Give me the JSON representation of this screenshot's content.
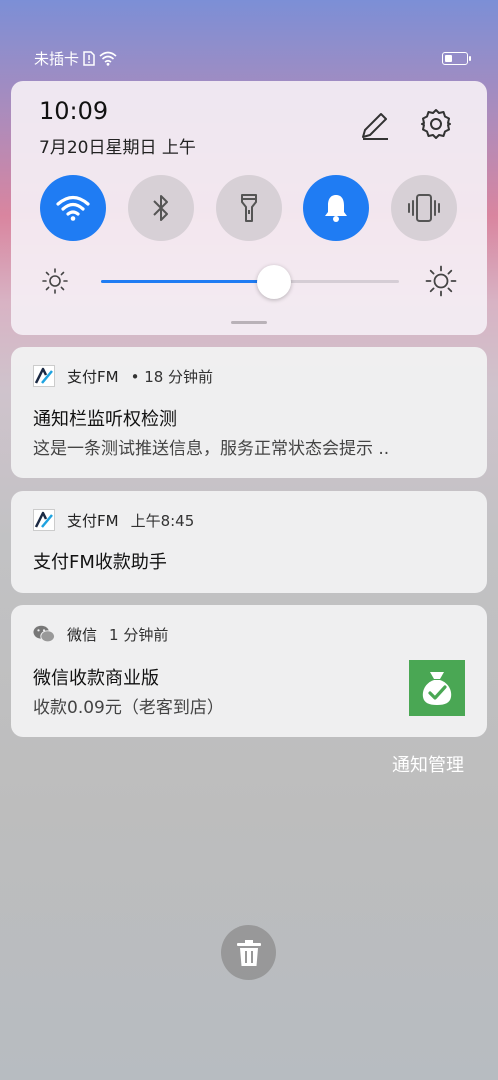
{
  "status_bar": {
    "carrier": "未插卡",
    "battery_level": 0.35
  },
  "quick_settings": {
    "time": "10:09",
    "date": "7月20日星期日 上午",
    "toggles": [
      {
        "name": "wifi",
        "on": true
      },
      {
        "name": "bluetooth",
        "on": false
      },
      {
        "name": "flashlight",
        "on": false
      },
      {
        "name": "sound",
        "on": true
      },
      {
        "name": "vibrate",
        "on": false
      }
    ],
    "brightness": 0.58,
    "accent_color": "#1f7cf3"
  },
  "notifications": [
    {
      "app": "支付FM",
      "time": "• 18 分钟前",
      "title": "通知栏监听权检测",
      "body": "这是一条测试推送信息，服务正常状态会提示 .."
    },
    {
      "app": "支付FM",
      "time": "上午8:45",
      "title": "支付FM收款助手",
      "body": ""
    },
    {
      "app": "微信",
      "time": "1 分钟前",
      "title": "微信收款商业版",
      "body": "收款0.09元（老客到店）"
    }
  ],
  "manage_label": "通知管理"
}
